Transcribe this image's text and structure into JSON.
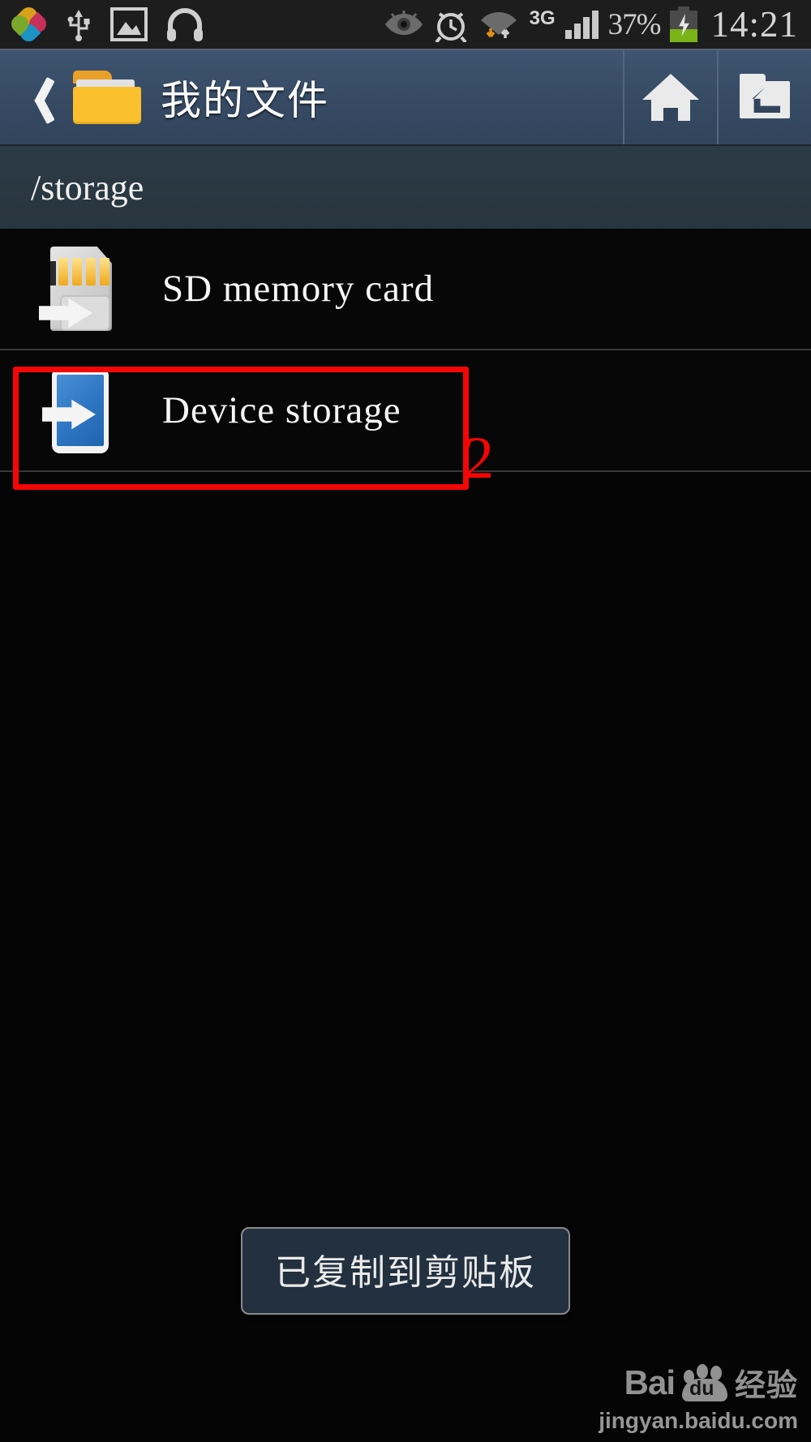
{
  "status_bar": {
    "left_icons": [
      "clover-icon",
      "usb-icon",
      "image-icon",
      "headphones-icon"
    ],
    "right_icons": [
      "eye-icon",
      "alarm-icon",
      "wifi-icon"
    ],
    "network_type": "3G",
    "battery_percent": "37%",
    "battery_state": "charging",
    "time": "14:21",
    "background": "#1d1d1d"
  },
  "app_bar": {
    "back_icon": "back-chevron-icon",
    "folder_icon": "folder-icon",
    "title": "我的文件",
    "actions": [
      {
        "name": "home",
        "icon": "home-icon"
      },
      {
        "name": "parent-folder",
        "icon": "folder-up-icon"
      }
    ],
    "background": "#36496 3"
  },
  "path_bar": {
    "path": "/storage",
    "background": "#2a3842"
  },
  "list": {
    "items": [
      {
        "icon": "sd-card-icon",
        "label": "SD memory card"
      },
      {
        "icon": "device-storage-icon",
        "label": "Device storage"
      }
    ]
  },
  "annotation": {
    "marker": "2",
    "color": "#f50505",
    "target": "Device storage",
    "shape": "rectangle"
  },
  "toast": {
    "message": "已复制到剪贴板",
    "background": "#22303f",
    "border": "#8a8a8a"
  },
  "watermark": {
    "brand": "Bai",
    "paw_text": "du",
    "suffix": "经验",
    "url": "jingyan.baidu.com"
  }
}
